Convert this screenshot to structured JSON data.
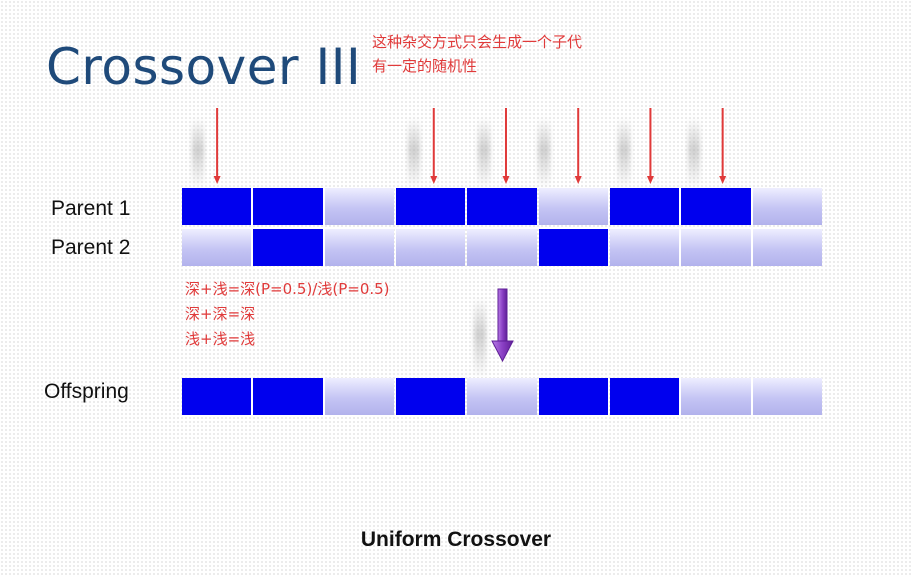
{
  "slide": {
    "title": "Crossover III",
    "note_line1": "这种杂交方式只会生成一个子代",
    "note_line2": "有一定的随机性",
    "rule1": "深+浅=深(P=0.5)/浅(P=0.5)",
    "rule2": "深+深=深",
    "rule3": "浅+浅=浅",
    "caption": "Uniform Crossover"
  },
  "rows": {
    "parent1": {
      "label": "Parent 1",
      "genes": [
        "dark",
        "dark",
        "light",
        "dark",
        "dark",
        "light",
        "dark",
        "dark",
        "light"
      ]
    },
    "parent2": {
      "label": "Parent 2",
      "genes": [
        "light",
        "dark",
        "light",
        "light",
        "light",
        "dark",
        "light",
        "light",
        "light"
      ]
    },
    "offspring": {
      "label": "Offspring",
      "genes": [
        "dark",
        "dark",
        "light",
        "dark",
        "light",
        "dark",
        "dark",
        "light",
        "light"
      ]
    }
  },
  "marked_gene_indices": [
    0,
    3,
    4,
    5,
    6,
    7
  ],
  "colors": {
    "dark_gene": "#0000ee",
    "light_gene": "#c4c4f4",
    "marker_red": "#e03a3a",
    "down_arrow_purple": "#8a3fc4",
    "title_blue": "#1f4a7a"
  }
}
